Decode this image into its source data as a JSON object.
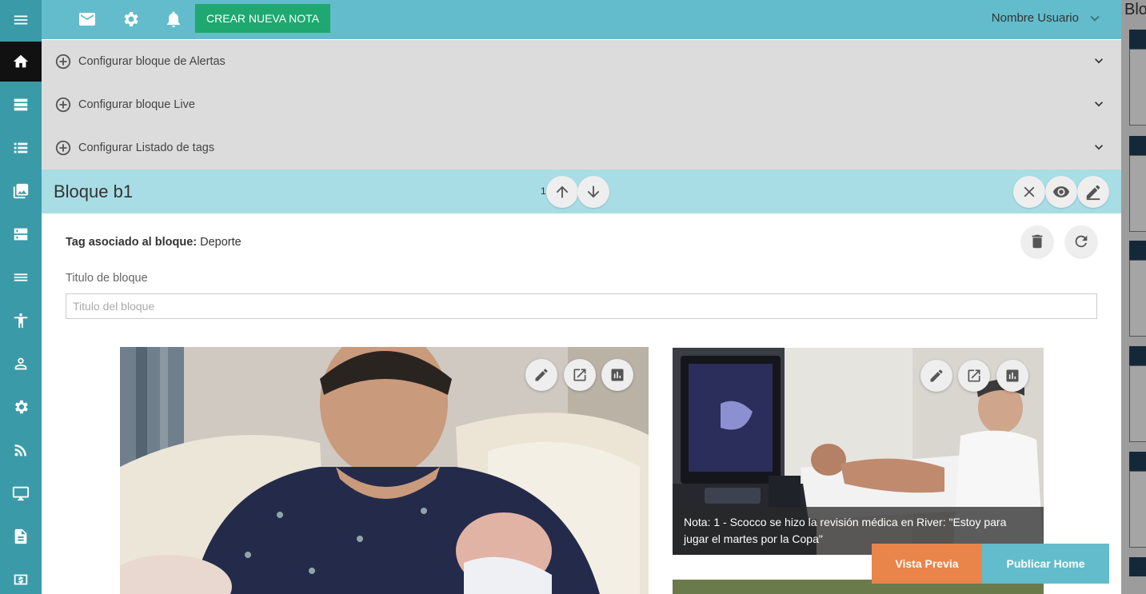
{
  "sidebar": {
    "items": [
      {
        "icon": "menu-icon"
      },
      {
        "icon": "home-icon",
        "active": true
      },
      {
        "icon": "view-agenda-icon"
      },
      {
        "icon": "view-list-icon"
      },
      {
        "icon": "photo-library-icon"
      },
      {
        "icon": "dns-icon"
      },
      {
        "icon": "reorder-icon"
      },
      {
        "icon": "accessibility-icon"
      },
      {
        "icon": "person-icon"
      },
      {
        "icon": "settings-icon"
      },
      {
        "icon": "rss-feed-icon"
      },
      {
        "icon": "desktop-icon"
      },
      {
        "icon": "description-icon"
      },
      {
        "icon": "money-icon"
      }
    ]
  },
  "topbar": {
    "new_note_label": "CREAR NUEVA NOTA",
    "user_name": "Nombre Usuario"
  },
  "config_rows": [
    {
      "label": "Configurar bloque de Alertas"
    },
    {
      "label": "Configurar bloque Live"
    },
    {
      "label": "Configurar Listado de tags"
    }
  ],
  "block": {
    "title": "Bloque b1",
    "position": "1",
    "tag_label": "Tag asociado al bloque:",
    "tag_value": "Deporte",
    "field_label": "Titulo de bloque",
    "field_placeholder": "Titulo del bloque"
  },
  "cards": [
    {
      "caption": ""
    },
    {
      "caption": "Nota: 1 - Scocco se hizo la revisión médica en River: \"Estoy para jugar el martes por la Copa\""
    }
  ],
  "footer": {
    "preview_label": "Vista Previa",
    "publish_label": "Publicar Home"
  },
  "right_panel": {
    "title": "Bloques"
  },
  "colors": {
    "sidebar": "#3b9aa8",
    "topbar": "#63bccb",
    "new_note_button": "#1fa870",
    "block_header": "#a8dde5",
    "preview_button": "#e9844a",
    "publish_button": "#63bccb"
  }
}
